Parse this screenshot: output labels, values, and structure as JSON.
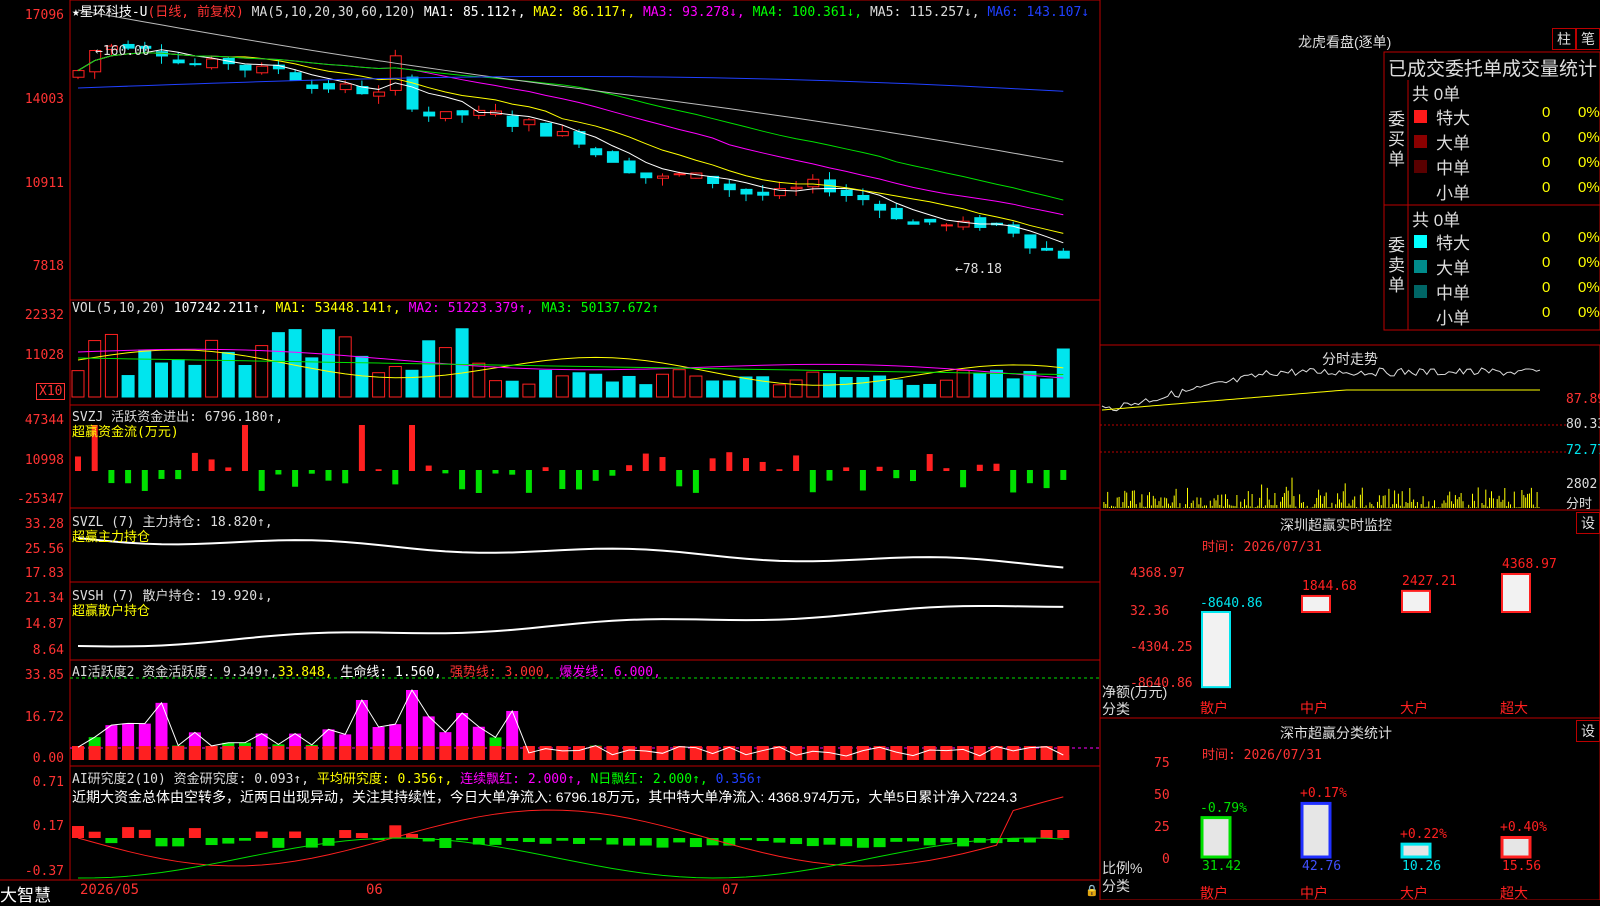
{
  "main": {
    "header": {
      "star": "★",
      "stock_name": "星环科技-U",
      "period": "(日线, 前复权)",
      "ma_label": "MA(5,10,20,30,60,120)",
      "ma1": "MA1: 85.112↑,",
      "ma2": "MA2: 86.117↑,",
      "ma3": "MA3: 93.278↓,",
      "ma4": "MA4: 100.361↓,",
      "ma5": "MA5: 115.257↓,",
      "ma6": "MA6: 143.107↓"
    },
    "price_axis": [
      "17096",
      "14003",
      "10911",
      "7818"
    ],
    "max_marker": "←160.00",
    "min_marker": "←78.18",
    "vol": {
      "label": "VOL(5,10,20)",
      "value": "107242.211↑,",
      "ma1": "MA1: 53448.141↑,",
      "ma2": "MA2: 51223.379↑,",
      "ma3": "MA3: 50137.672↑",
      "axis": [
        "22332",
        "11028"
      ],
      "multiplier": "X10"
    },
    "svzj": {
      "label": "SVZJ  活跃资金进出: 6796.180↑,",
      "sub": "超赢资金流(万元)",
      "axis": [
        "47344",
        "10998",
        "-25347"
      ]
    },
    "svzl": {
      "label": "SVZL (7) 主力持仓: 18.820↑,",
      "sub": "超赢主力持仓",
      "axis": [
        "33.28",
        "25.56",
        "17.83"
      ]
    },
    "svsh": {
      "label": "SVSH (7) 散户持仓: 19.920↓,",
      "sub": "超赢散户持仓",
      "axis": [
        "21.34",
        "14.87",
        "8.64"
      ]
    },
    "ai_active": {
      "label": "AI活跃度2 资金活跃度: 9.349↑,",
      "v2": "33.848,",
      "life": "生命线: 1.560,",
      "strong": "强势线: 3.000,",
      "burst": "爆发线: 6.000,",
      "axis": [
        "33.85",
        "16.72",
        "0.00"
      ]
    },
    "ai_research": {
      "label": "AI研究度2(10) 资金研究度: 0.093↑,",
      "avg": "平均研究度: 0.356↑,",
      "cont": "连续飘红: 2.000↑,",
      "nday": "N日飘红: 2.000↑,",
      "last": "0.356↑",
      "comment": "近期大资金总体由空转多，近两日出现异动，关注其持续性，今日大单净流入: 6796.18万元，其中特大单净流入: 4368.974万元，大单5日累计净入7224.3",
      "axis": [
        "0.71",
        "0.17",
        "-0.37"
      ]
    },
    "dates": [
      "2026/05",
      "06",
      "07"
    ],
    "brand": "大智慧",
    "colors": {
      "up": "#ff2020",
      "down": "#00e5ee",
      "green": "#00e000",
      "magenta": "#ff00ff",
      "yellow": "#ffff00",
      "axis": "#ff3333"
    }
  },
  "right": {
    "lhb_title": "龙虎看盘(逐单)",
    "btn_zhu": "柱",
    "btn_bi": "笔",
    "stat_title": "已成交委托单成交量统计",
    "buy": {
      "side_label": "委买单",
      "total": "共 0单",
      "rows": [
        {
          "name": "特大",
          "qty": "0",
          "pct": "0%",
          "color": "#ff1a1a"
        },
        {
          "name": "大单",
          "qty": "0",
          "pct": "0%",
          "color": "#8b0000"
        },
        {
          "name": "中单",
          "qty": "0",
          "pct": "0%",
          "color": "#5a0000"
        },
        {
          "name": "小单",
          "qty": "0",
          "pct": "0%",
          "color": "#000000"
        }
      ]
    },
    "sell": {
      "side_label": "委卖单",
      "total": "共 0单",
      "rows": [
        {
          "name": "特大",
          "qty": "0",
          "pct": "0%",
          "color": "#00ffff"
        },
        {
          "name": "大单",
          "qty": "0",
          "pct": "0%",
          "color": "#008b8b"
        },
        {
          "name": "中单",
          "qty": "0",
          "pct": "0%",
          "color": "#006666"
        },
        {
          "name": "小单",
          "qty": "0",
          "pct": "0%",
          "color": "#000000"
        }
      ]
    },
    "intraday": {
      "title": "分时走势",
      "axis": [
        "87.89",
        "80.33",
        "72.77"
      ],
      "vol_top": "2802",
      "vol_unit": "分时"
    },
    "sz_monitor": {
      "title": "深圳超赢实时监控",
      "btn": "设",
      "time": "时间: 2026/07/31",
      "axis": [
        "4368.97",
        "32.36",
        "-4304.25",
        "-8640.86"
      ],
      "ylabel": "净额(万元)",
      "xlabel": "分类",
      "categories": [
        "散户",
        "中户",
        "大户",
        "超大"
      ],
      "values": [
        -8640.86,
        1844.68,
        2427.21,
        4368.97
      ],
      "value_labels": [
        "-8640.86",
        "1844.68",
        "2427.21",
        "4368.97"
      ]
    },
    "sz_stats": {
      "title": "深市超赢分类统计",
      "btn": "设",
      "time": "时间: 2026/07/31",
      "axis": [
        "75",
        "50",
        "25",
        "0"
      ],
      "ylabel": "比例%",
      "xlabel": "分类",
      "categories": [
        "散户",
        "中户",
        "大户",
        "超大"
      ],
      "values": [
        31.42,
        42.76,
        10.26,
        15.56
      ],
      "changes": [
        "-0.79%",
        "+0.17%",
        "+0.22%",
        "+0.40%"
      ],
      "value_labels": [
        "31.42",
        "42.76",
        "10.26",
        "15.56"
      ]
    }
  }
}
